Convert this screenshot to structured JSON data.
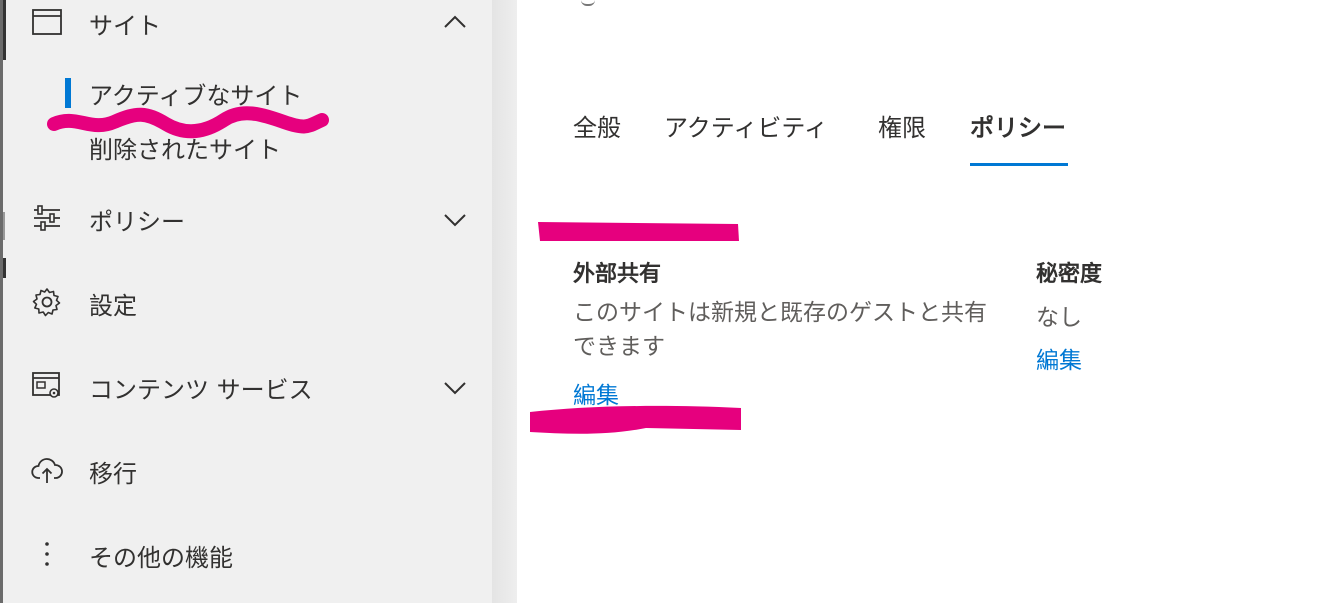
{
  "sidebar": {
    "sites": {
      "label": "サイト",
      "icon": "browser-window-icon",
      "expanded": true
    },
    "sites_children": [
      {
        "label": "アクティブなサイト",
        "selected": true
      },
      {
        "label": "削除されたサイト",
        "selected": false
      }
    ],
    "items": [
      {
        "label": "ポリシー",
        "icon": "sliders-icon",
        "chevron": "down"
      },
      {
        "label": "設定",
        "icon": "gear-icon"
      },
      {
        "label": "コンテンツ サービス",
        "icon": "content-services-icon",
        "chevron": "down"
      },
      {
        "label": "移行",
        "icon": "cloud-upload-icon"
      },
      {
        "label": "その他の機能",
        "icon": "more-vertical-icon"
      }
    ]
  },
  "tabs": [
    {
      "label": "全般",
      "active": false
    },
    {
      "label": "アクティビティ",
      "active": false
    },
    {
      "label": "権限",
      "active": false
    },
    {
      "label": "ポリシー",
      "active": true
    }
  ],
  "policies": {
    "external_sharing": {
      "title": "外部共有",
      "description": "このサイトは新規と既存のゲストと共有できます",
      "edit_label": "編集"
    },
    "sensitivity": {
      "title": "秘密度",
      "value": "なし",
      "edit_label": "編集"
    }
  },
  "colors": {
    "accent": "#0078d4",
    "redaction": "#e6007e",
    "nav_background": "#f0f0f0"
  }
}
